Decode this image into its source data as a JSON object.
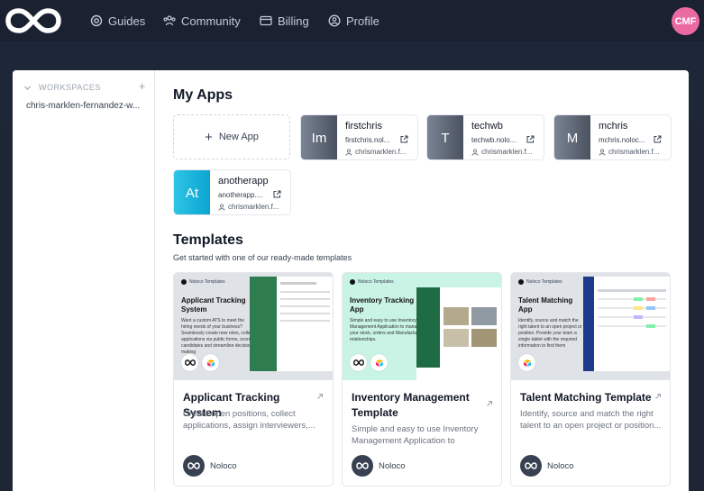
{
  "nav": {
    "logo_icon": "noloco-infinity-logo",
    "items": [
      {
        "label": "Guides",
        "icon": "life-ring-icon"
      },
      {
        "label": "Community",
        "icon": "users-icon"
      },
      {
        "label": "Billing",
        "icon": "credit-card-icon"
      },
      {
        "label": "Profile",
        "icon": "user-circle-icon"
      }
    ],
    "avatar_initials": "CMF",
    "avatar_color": "#ec6aa2"
  },
  "sidebar": {
    "section_label": "WORKSPACES",
    "add_symbol": "+",
    "workspace": "chris-marklen-fernandez-w..."
  },
  "my_apps": {
    "title": "My Apps",
    "new_app_label": "New App",
    "apps": [
      {
        "initials": "Im",
        "name": "firstchris",
        "url": "firstchris.nol...",
        "owner": "chrismarklen.f..."
      },
      {
        "initials": "T",
        "name": "techwb",
        "url": "techwb.nolo...",
        "owner": "chrismarklen.f..."
      },
      {
        "initials": "M",
        "name": "mchris",
        "url": "mchris.noloc...",
        "owner": "chrismarklen.f..."
      },
      {
        "initials": "At",
        "name": "anotherapp",
        "url": "anotherapp....",
        "owner": "chrismarklen.f..."
      }
    ]
  },
  "templates": {
    "title": "Templates",
    "subtitle": "Get started with one of our ready-made templates",
    "items": [
      {
        "name": "Applicant Tracking System",
        "description": "Create open positions, collect applications, assign interviewers,...",
        "author": "Noloco",
        "preview_brand": "Noloco Templates",
        "preview_title": "Applicant Tracking System",
        "preview_desc": "Want a custom ATS to meet the hiring needs of your business? Seamlessly create new roles, collect applications via public forms, score candidates and streamline decision-making",
        "preview_bg": "#dfe3e8"
      },
      {
        "name": "Inventory Management Template",
        "description": "Simple and easy to use Inventory Management Application to manage...",
        "author": "Noloco",
        "preview_brand": "Noloco Templates",
        "preview_title": "Inventory Tracking App",
        "preview_desc": "Simple and easy to use Inventory Management Application to manage your stock, orders and Manufacturer relationships.",
        "preview_bg": "#c9f3e4"
      },
      {
        "name": "Talent Matching Template",
        "description": "Identify, source and match the right talent to an open project or position...",
        "author": "Noloco",
        "preview_brand": "Noloco Templates",
        "preview_title": "Talent Matching App",
        "preview_desc": "Identify, source and match the right talent to an open project or position. Provide your team a single tablet with the required information to find them",
        "preview_bg": "#dfe3e8"
      }
    ]
  }
}
